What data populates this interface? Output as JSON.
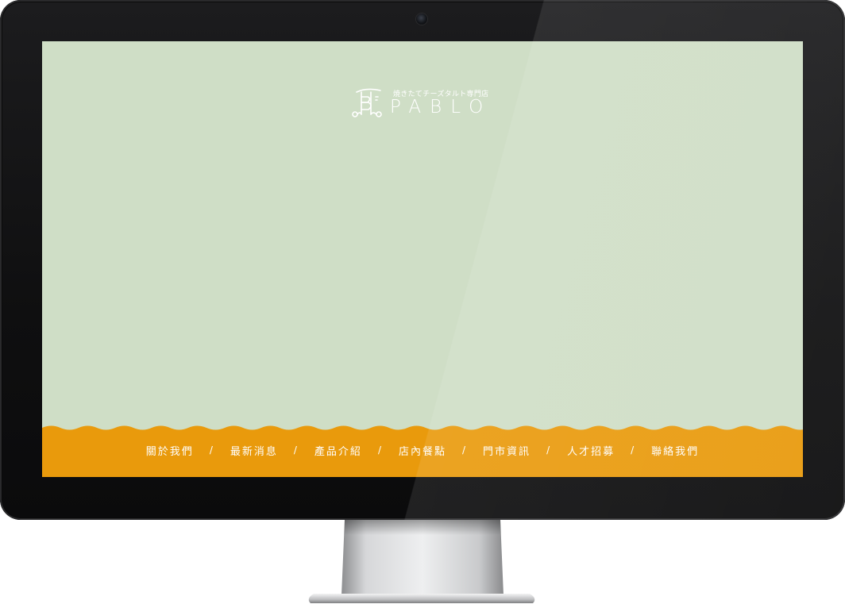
{
  "brand": {
    "tagline": "焼きたてチーズタルト専門店",
    "name": "PABLO"
  },
  "nav": {
    "items": [
      {
        "label": "關於我們"
      },
      {
        "label": "最新消息"
      },
      {
        "label": "產品介紹"
      },
      {
        "label": "店內餐點"
      },
      {
        "label": "門市資訊"
      },
      {
        "label": "人才招募"
      },
      {
        "label": "聯絡我們"
      }
    ],
    "separator": "/"
  },
  "colors": {
    "screen_background": "#cfdec6",
    "footer_orange": "#e99a0c",
    "text_white": "#ffffff",
    "bezel": "#0f0f10"
  },
  "icons": {
    "logo": "pablo-logo-icon",
    "camera": "webcam-icon"
  }
}
